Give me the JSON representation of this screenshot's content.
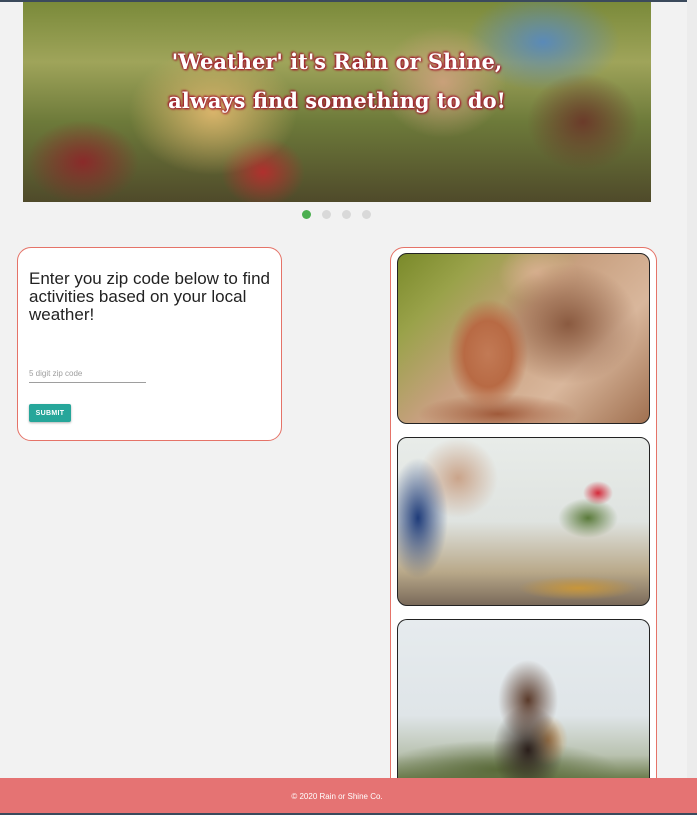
{
  "hero": {
    "caption_line1": "'Weather' it's Rain or Shine,",
    "caption_line2": "always find something to do!",
    "slide_count": 4,
    "active_slide": 1,
    "dot_active_color": "#4caf50"
  },
  "zip_form": {
    "heading": "Enter you zip code below to find activities based on your local weather!",
    "input_placeholder": "5 digit zip code",
    "input_value": "",
    "submit_label": "SUBMIT",
    "button_color": "#26a69a",
    "card_border_color": "#e57368"
  },
  "activities": [
    {
      "image": "pottery-photo"
    },
    {
      "image": "painting-photo"
    },
    {
      "image": "guitar-photo"
    }
  ],
  "footer": {
    "text": "© 2020 Rain or Shine Co.",
    "background_color": "#e57373"
  }
}
